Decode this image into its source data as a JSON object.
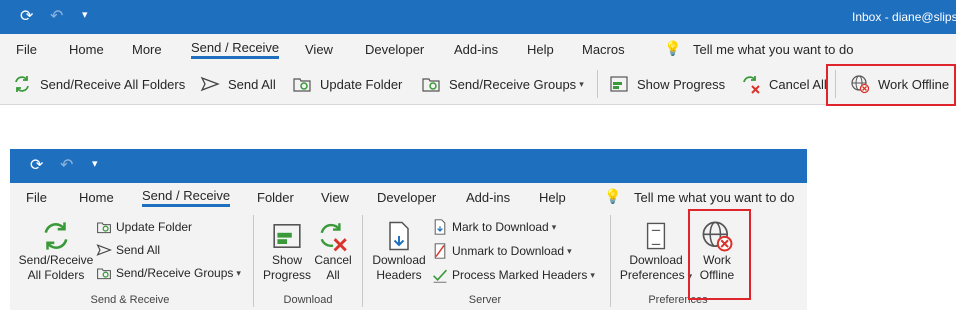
{
  "top": {
    "title": "Inbox - diane@slips",
    "tabs": [
      "File",
      "Home",
      "More",
      "Send / Receive",
      "View",
      "Developer",
      "Add-ins",
      "Help",
      "Macros"
    ],
    "tell_me": "Tell me what you want to do",
    "toolbar": {
      "send_receive_all": "Send/Receive All Folders",
      "send_all": "Send All",
      "update_folder": "Update Folder",
      "send_receive_groups": "Send/Receive Groups",
      "show_progress": "Show Progress",
      "cancel_all": "Cancel All",
      "work_offline": "Work Offline"
    }
  },
  "bottom": {
    "tabs": [
      "File",
      "Home",
      "Send / Receive",
      "Folder",
      "View",
      "Developer",
      "Add-ins",
      "Help"
    ],
    "tell_me": "Tell me what you want to do",
    "send_receive_group": {
      "big_line1": "Send/Receive",
      "big_line2": "All Folders",
      "update_folder": "Update Folder",
      "send_all": "Send All",
      "groups": "Send/Receive Groups",
      "label": "Send & Receive"
    },
    "download_group": {
      "show_l1": "Show",
      "show_l2": "Progress",
      "cancel_l1": "Cancel",
      "cancel_l2": "All",
      "label": "Download"
    },
    "server_group": {
      "dl_l1": "Download",
      "dl_l2": "Headers",
      "mark": "Mark to Download",
      "unmark": "Unmark to Download",
      "process": "Process Marked Headers",
      "label": "Server"
    },
    "preferences_group": {
      "pref_l1": "Download",
      "pref_l2": "Preferences",
      "offline_l1": "Work",
      "offline_l2": "Offline",
      "label": "Preferences"
    }
  },
  "colors": {
    "accent": "#1f6fbf",
    "highlight": "#e0242c",
    "ribbon_bg": "#f3f3f3"
  }
}
